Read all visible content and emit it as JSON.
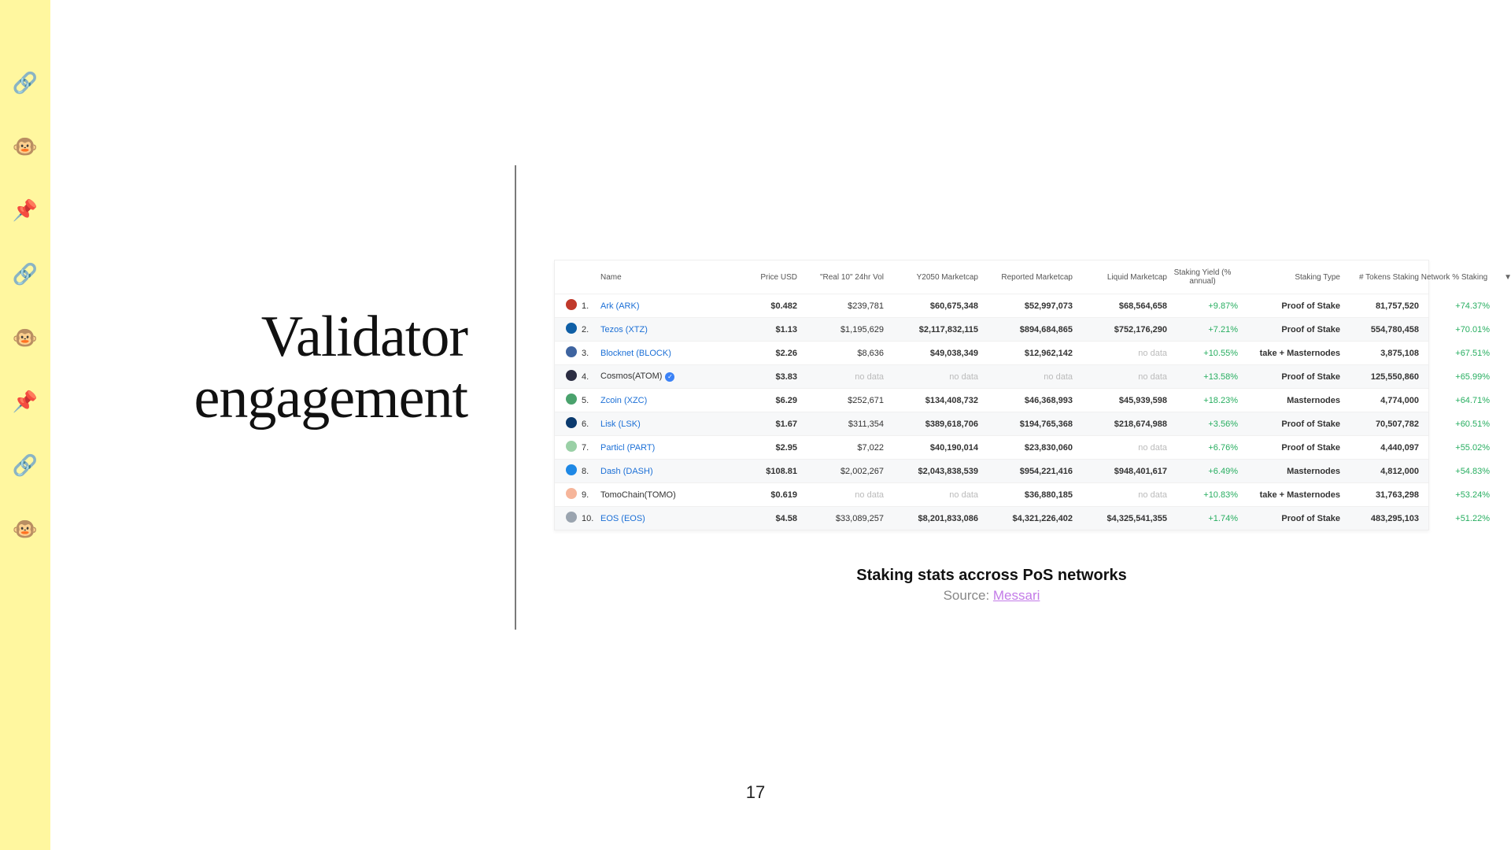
{
  "heading_line1": "Validator",
  "heading_line2": "engagement",
  "page_number": "17",
  "caption_title": "Staking stats accross PoS networks",
  "caption_source_prefix": "Source: ",
  "caption_source_link_text": "Messari",
  "table": {
    "headers": {
      "name": "Name",
      "price": "Price USD",
      "vol": "\"Real 10\" 24hr Vol",
      "y2050": "Y2050 Marketcap",
      "reported": "Reported Marketcap",
      "liquid": "Liquid Marketcap",
      "yield": "Staking Yield (% annual)",
      "type": "Staking Type",
      "tokens": "# Tokens Staking",
      "network_pct": "Network % Staking"
    },
    "rows": [
      {
        "rank": "1.",
        "logo_color": "#c0392b",
        "name": "Ark (ARK)",
        "link": true,
        "badge": false,
        "price": "$0.482",
        "vol": "$239,781",
        "y2050": "$60,675,348",
        "reported": "$52,997,073",
        "liquid": "$68,564,658",
        "yield": "+9.87%",
        "type": "Proof of Stake",
        "tokens": "81,757,520",
        "pct": "+74.37%"
      },
      {
        "rank": "2.",
        "logo_color": "#0f5fa6",
        "name": "Tezos (XTZ)",
        "link": true,
        "badge": false,
        "price": "$1.13",
        "vol": "$1,195,629",
        "y2050": "$2,117,832,115",
        "reported": "$894,684,865",
        "liquid": "$752,176,290",
        "yield": "+7.21%",
        "type": "Proof of Stake",
        "tokens": "554,780,458",
        "pct": "+70.01%"
      },
      {
        "rank": "3.",
        "logo_color": "#3e64a0",
        "name": "Blocknet (BLOCK)",
        "link": true,
        "badge": false,
        "price": "$2.26",
        "vol": "$8,636",
        "y2050": "$49,038,349",
        "reported": "$12,962,142",
        "liquid": "no data",
        "yield": "+10.55%",
        "type": "take + Masternodes",
        "tokens": "3,875,108",
        "pct": "+67.51%"
      },
      {
        "rank": "4.",
        "logo_color": "#2b2d42",
        "name": "Cosmos(ATOM)",
        "link": false,
        "badge": true,
        "price": "$3.83",
        "vol": "no data",
        "y2050": "no data",
        "reported": "no data",
        "liquid": "no data",
        "yield": "+13.58%",
        "type": "Proof of Stake",
        "tokens": "125,550,860",
        "pct": "+65.99%"
      },
      {
        "rank": "5.",
        "logo_color": "#4aa26d",
        "name": "Zcoin (XZC)",
        "link": true,
        "badge": false,
        "price": "$6.29",
        "vol": "$252,671",
        "y2050": "$134,408,732",
        "reported": "$46,368,993",
        "liquid": "$45,939,598",
        "yield": "+18.23%",
        "type": "Masternodes",
        "tokens": "4,774,000",
        "pct": "+64.71%"
      },
      {
        "rank": "6.",
        "logo_color": "#0b3a6e",
        "name": "Lisk (LSK)",
        "link": true,
        "badge": false,
        "price": "$1.67",
        "vol": "$311,354",
        "y2050": "$389,618,706",
        "reported": "$194,765,368",
        "liquid": "$218,674,988",
        "yield": "+3.56%",
        "type": "Proof of Stake",
        "tokens": "70,507,782",
        "pct": "+60.51%"
      },
      {
        "rank": "7.",
        "logo_color": "#9ad0a6",
        "name": "Particl (PART)",
        "link": true,
        "badge": false,
        "price": "$2.95",
        "vol": "$7,022",
        "y2050": "$40,190,014",
        "reported": "$23,830,060",
        "liquid": "no data",
        "yield": "+6.76%",
        "type": "Proof of Stake",
        "tokens": "4,440,097",
        "pct": "+55.02%"
      },
      {
        "rank": "8.",
        "logo_color": "#1e88e5",
        "name": "Dash (DASH)",
        "link": true,
        "badge": false,
        "price": "$108.81",
        "vol": "$2,002,267",
        "y2050": "$2,043,838,539",
        "reported": "$954,221,416",
        "liquid": "$948,401,617",
        "yield": "+6.49%",
        "type": "Masternodes",
        "tokens": "4,812,000",
        "pct": "+54.83%"
      },
      {
        "rank": "9.",
        "logo_color": "#f6b59a",
        "name": "TomoChain(TOMO)",
        "link": false,
        "badge": false,
        "price": "$0.619",
        "vol": "no data",
        "y2050": "no data",
        "reported": "$36,880,185",
        "liquid": "no data",
        "yield": "+10.83%",
        "type": "take + Masternodes",
        "tokens": "31,763,298",
        "pct": "+53.24%"
      },
      {
        "rank": "10.",
        "logo_color": "#9aa4af",
        "name": "EOS (EOS)",
        "link": true,
        "badge": false,
        "price": "$4.58",
        "vol": "$33,089,257",
        "y2050": "$8,201,833,086",
        "reported": "$4,321,226,402",
        "liquid": "$4,325,541,355",
        "yield": "+1.74%",
        "type": "Proof of Stake",
        "tokens": "483,295,103",
        "pct": "+51.22%"
      }
    ]
  },
  "decor_icons": [
    "🔗",
    "🐵",
    "📌",
    "🔗",
    "🐵",
    "📌",
    "🔗",
    "🐵"
  ]
}
